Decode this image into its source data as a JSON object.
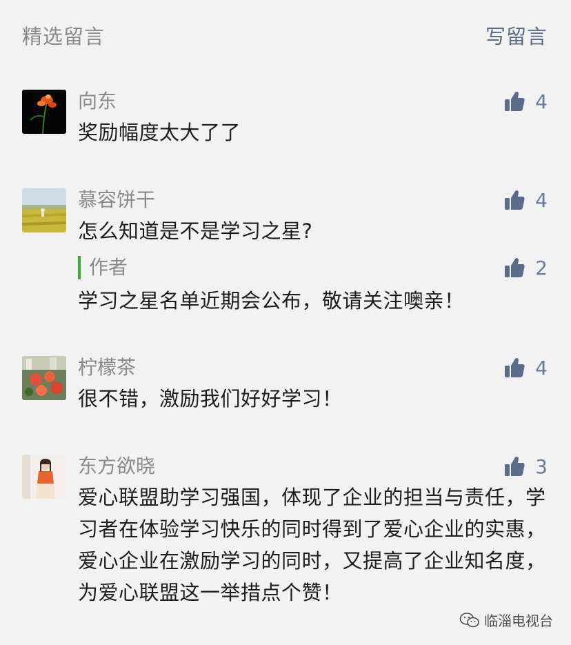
{
  "header": {
    "title": "精选留言",
    "write_label": "写留言"
  },
  "comments": [
    {
      "name": "向东",
      "text": "奖励幅度太大了了",
      "likes": "4"
    },
    {
      "name": "慕容饼干",
      "text": "怎么知道是不是学习之星?",
      "likes": "4",
      "reply": {
        "tag": "作者",
        "text": "学习之星名单近期会公布，敬请关注噢亲！",
        "likes": "2"
      }
    },
    {
      "name": "柠檬茶",
      "text": "很不错，激励我们好好学习！",
      "likes": "4"
    },
    {
      "name": "东方欲晓",
      "text": "爱心联盟助学习强国，体现了企业的担当与责任，学习者在体验学习快乐的同时得到了爱心企业的实惠，爱心企业在激励学习的同时，又提高了企业知名度，为爱心联盟这一举措点个赞！",
      "likes": "3"
    }
  ],
  "watermark": {
    "text": "临淄电视台",
    "icon": "wechat-icon"
  },
  "colors": {
    "background": "#f2f2f2",
    "link": "#5b6b8c",
    "author_bar": "#3aaa35",
    "like": "#6b7a96"
  }
}
